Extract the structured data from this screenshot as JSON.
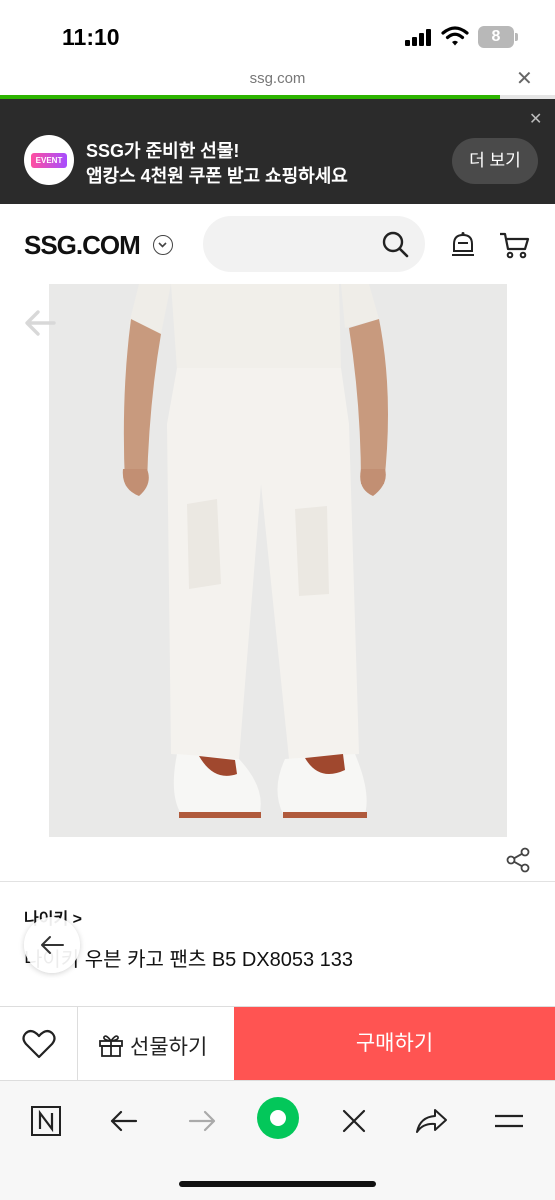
{
  "status_bar": {
    "time": "11:10",
    "battery_level": "8"
  },
  "browser": {
    "url": "ssg.com",
    "load_progress": 0.9
  },
  "promo": {
    "badge_text": "EVENT",
    "line1": "SSG가 준비한 선물!",
    "line2": "앱캉스 4천원 쿠폰 받고 쇼핑하세요",
    "more_label": "더 보기"
  },
  "header": {
    "logo": "SSG.COM"
  },
  "product": {
    "brand": "나이키 >",
    "title": "나이키 우븐 카고 팬츠 B5 DX8053 133"
  },
  "actions": {
    "gift_label": "선물하기",
    "buy_label": "구매하기"
  },
  "icons": {
    "search": "search-icon",
    "bot": "chatbot-icon",
    "cart": "cart-icon",
    "share": "share-icon",
    "heart": "heart-icon",
    "gift": "gift-icon"
  },
  "colors": {
    "buy": "#ff5452",
    "progress": "#2db400",
    "naver_green": "#03c75a"
  }
}
